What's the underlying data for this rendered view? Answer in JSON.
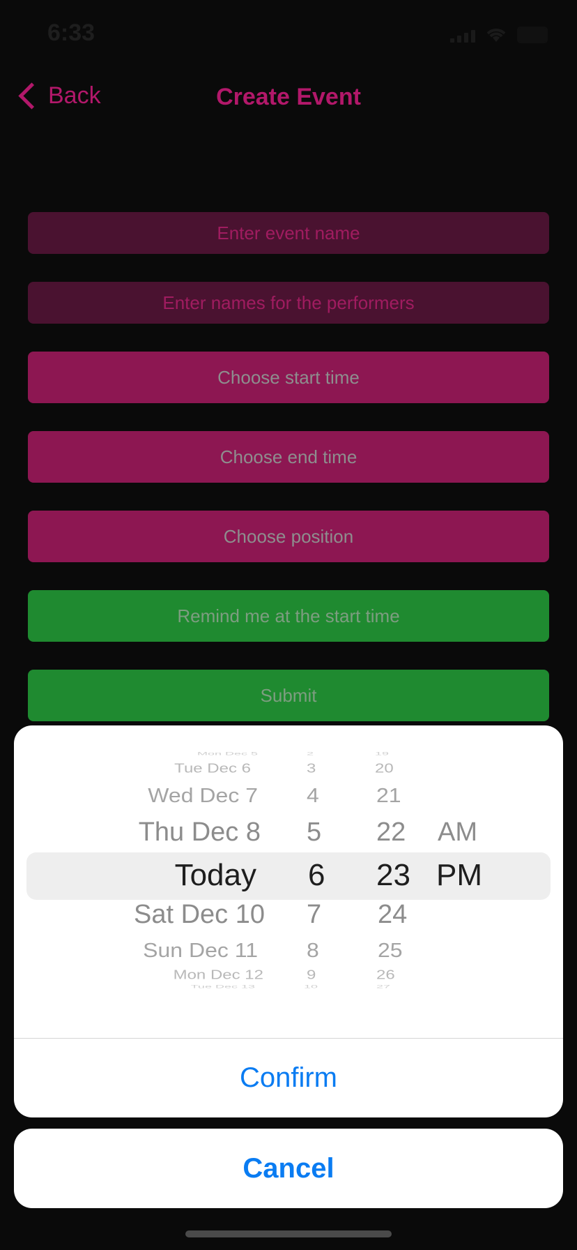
{
  "status_bar": {
    "time": "6:33"
  },
  "nav": {
    "back_label": "Back",
    "title": "Create Event"
  },
  "form": {
    "event_name_placeholder": "Enter event name",
    "performers_placeholder": "Enter names for the performers",
    "start_time_label": "Choose start time",
    "end_time_label": "Choose end time",
    "position_label": "Choose position",
    "remind_label": "Remind me at the start time",
    "submit_label": "Submit"
  },
  "picker": {
    "date_column": [
      "Mon Dec 5",
      "Tue Dec 6",
      "Wed Dec 7",
      "Thu Dec 8",
      "Today",
      "Sat Dec 10",
      "Sun Dec 11",
      "Mon Dec 12",
      "Tue Dec 13"
    ],
    "hour_column": [
      "2",
      "3",
      "4",
      "5",
      "6",
      "7",
      "8",
      "9",
      "10"
    ],
    "minute_column": [
      "19",
      "20",
      "21",
      "22",
      "23",
      "24",
      "25",
      "26",
      "27"
    ],
    "ampm_column": [
      "AM",
      "PM"
    ],
    "confirm_label": "Confirm",
    "cancel_label": "Cancel"
  },
  "colors": {
    "accent_pink": "#b2186a",
    "button_pink": "#8d1752",
    "input_pink": "#4a1230",
    "green": "#1f8a30",
    "ios_blue": "#0a7cf2"
  }
}
